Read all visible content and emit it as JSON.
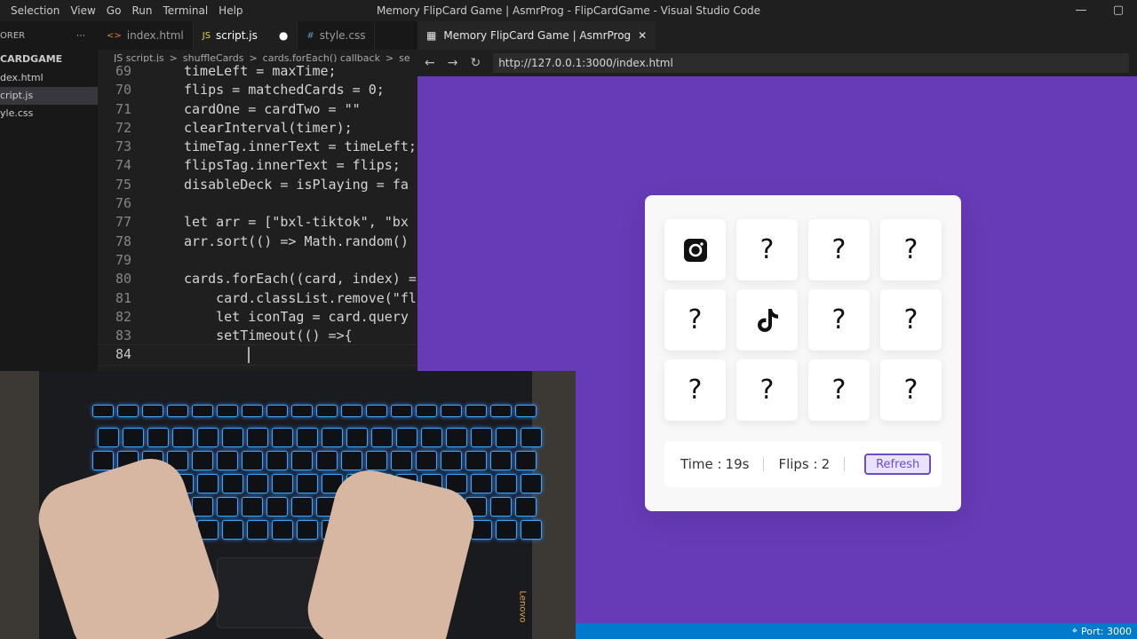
{
  "window": {
    "title": "Memory FlipCard Game | AsmrProg - FlipCardGame - Visual Studio Code"
  },
  "menu": [
    "Selection",
    "View",
    "Go",
    "Run",
    "Terminal",
    "Help"
  ],
  "explorer": {
    "header": "ORER",
    "project": "CARDGAME",
    "files": [
      "dex.html",
      "cript.js",
      "yle.css"
    ],
    "active_index": 1
  },
  "editor_tabs": [
    {
      "label": "index.html",
      "ext": "<>"
    },
    {
      "label": "script.js",
      "ext": "JS"
    },
    {
      "label": "style.css",
      "ext": "#"
    }
  ],
  "breadcrumbs": [
    "JS script.js",
    ">",
    "shuffleCards",
    ">",
    "cards.forEach() callback",
    ">",
    "se"
  ],
  "code_lines": [
    {
      "n": "69",
      "text": "timeLeft = maxTime;"
    },
    {
      "n": "70",
      "text": "flips = matchedCards = 0;"
    },
    {
      "n": "71",
      "text": "cardOne = cardTwo = \"\""
    },
    {
      "n": "72",
      "text": "clearInterval(timer);"
    },
    {
      "n": "73",
      "text": "timeTag.innerText = timeLeft;"
    },
    {
      "n": "74",
      "text": "flipsTag.innerText = flips;"
    },
    {
      "n": "75",
      "text": "disableDeck = isPlaying = fa"
    },
    {
      "n": "76",
      "text": ""
    },
    {
      "n": "77",
      "text": "let arr = [\"bxl-tiktok\", \"bx"
    },
    {
      "n": "78",
      "text": "arr.sort(() => Math.random()"
    },
    {
      "n": "79",
      "text": ""
    },
    {
      "n": "80",
      "text": "cards.forEach((card, index) ="
    },
    {
      "n": "81",
      "text": "    card.classList.remove(\"fl"
    },
    {
      "n": "82",
      "text": "    let iconTag = card.query"
    },
    {
      "n": "83",
      "text": "    setTimeout(() =>{"
    },
    {
      "n": "84",
      "text": "        "
    }
  ],
  "browser": {
    "tab_title": "Memory FlipCard Game | AsmrProg",
    "url": "http://127.0.0.1:3000/index.html"
  },
  "game": {
    "cards": [
      "instagram-icon",
      "?",
      "?",
      "?",
      "?",
      "tiktok-icon",
      "?",
      "?",
      "?",
      "?",
      "?",
      "?"
    ],
    "time_label": "Time :",
    "time_value": "19s",
    "flips_label": "Flips :",
    "flips_value": "2",
    "refresh_label": "Refresh"
  },
  "status": {
    "port": "Port: 3000"
  },
  "photo": {
    "brand": "Lenovo"
  },
  "colors": {
    "browser_bg": "#673ab7",
    "accent": "#6e4cc4",
    "statusbar": "#007acc"
  }
}
